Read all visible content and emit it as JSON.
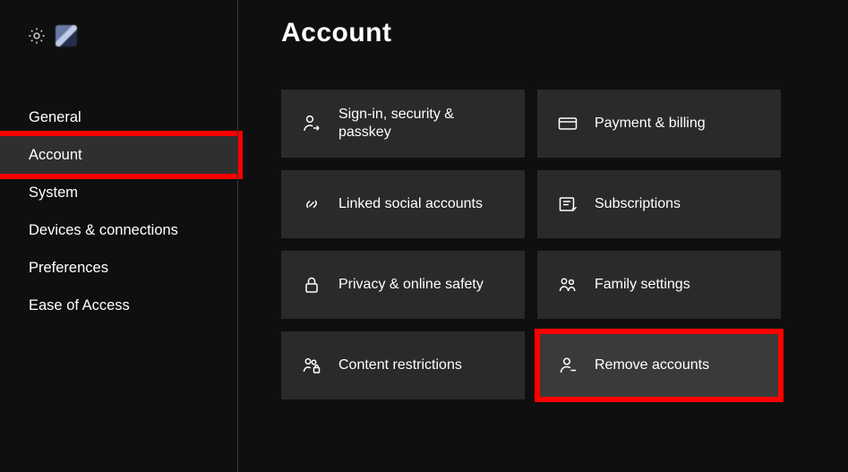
{
  "header": {
    "title": "Account"
  },
  "sidebar": {
    "items": [
      {
        "label": "General"
      },
      {
        "label": "Account"
      },
      {
        "label": "System"
      },
      {
        "label": "Devices & connections"
      },
      {
        "label": "Preferences"
      },
      {
        "label": "Ease of Access"
      }
    ],
    "selected_index": 1
  },
  "cards": [
    {
      "icon": "person-arrow-icon",
      "label": "Sign-in, security & passkey"
    },
    {
      "icon": "credit-card-icon",
      "label": "Payment & billing"
    },
    {
      "icon": "link-icon",
      "label": "Linked social accounts"
    },
    {
      "icon": "subscription-icon",
      "label": "Subscriptions"
    },
    {
      "icon": "lock-icon",
      "label": "Privacy & online safety"
    },
    {
      "icon": "family-icon",
      "label": "Family settings"
    },
    {
      "icon": "person-lock-icon",
      "label": "Content restrictions"
    },
    {
      "icon": "person-minus-icon",
      "label": "Remove accounts"
    }
  ],
  "highlights": {
    "sidebar_item_index": 1,
    "card_index": 7
  }
}
